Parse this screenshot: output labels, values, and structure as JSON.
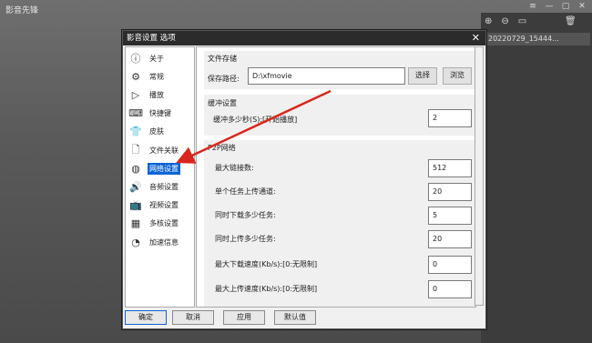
{
  "app": {
    "title": "影音先锋"
  },
  "side_panel": {
    "file_item": "20220729_15444..."
  },
  "dialog": {
    "title": "影音设置 选项",
    "nav": [
      {
        "label": "关于",
        "icon": "info-icon",
        "glyph": "ⓘ"
      },
      {
        "label": "常规",
        "icon": "gear-icon",
        "glyph": "⚙"
      },
      {
        "label": "播放",
        "icon": "play-icon",
        "glyph": "▷"
      },
      {
        "label": "快捷键",
        "icon": "keyboard-icon",
        "glyph": "⌨"
      },
      {
        "label": "皮肤",
        "icon": "shirt-icon",
        "glyph": "👕"
      },
      {
        "label": "文件关联",
        "icon": "file-icon",
        "glyph": "🗋"
      },
      {
        "label": "网络设置",
        "icon": "network-icon",
        "glyph": "◍"
      },
      {
        "label": "音频设置",
        "icon": "audio-icon",
        "glyph": "🔊"
      },
      {
        "label": "视频设置",
        "icon": "tv-icon",
        "glyph": "📺"
      },
      {
        "label": "多核设置",
        "icon": "cpu-icon",
        "glyph": "▦"
      },
      {
        "label": "加速信息",
        "icon": "speedometer-icon",
        "glyph": "◔"
      }
    ],
    "selected_nav": "网络设置",
    "file_storage": {
      "heading": "文件存储",
      "save_path_label": "保存路径:",
      "save_path_value": "D:\\xfmovie",
      "select_button": "选择",
      "browse_button": "浏览"
    },
    "buffer": {
      "heading": "缓冲设置",
      "label": "缓冲多少秒(S):[开始播放]",
      "value": "2"
    },
    "p2p": {
      "heading": "P2P网络",
      "rows": [
        {
          "label": "最大链接数:",
          "value": "512"
        },
        {
          "label": "单个任务上传通道:",
          "value": "20"
        },
        {
          "label": "同时下载多少任务:",
          "value": "5"
        },
        {
          "label": "同时上传多少任务:",
          "value": "20"
        },
        {
          "label": "最大下载速度(Kb/s):[0:无限制]",
          "value": "0"
        },
        {
          "label": "最大上传速度(Kb/s):[0:无限制]",
          "value": "0"
        }
      ]
    },
    "footer": {
      "ok": "确定",
      "cancel": "取消",
      "apply": "应用",
      "default": "默认值"
    }
  },
  "colors": {
    "accent": "#0a64d6",
    "arrow": "#d9261c",
    "titlebar": "#2b2b2b"
  }
}
